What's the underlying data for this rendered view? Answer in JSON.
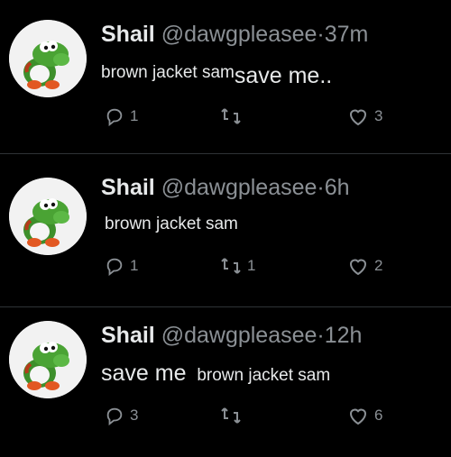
{
  "tweets": [
    {
      "name": "Shail",
      "handle": "@dawgpleasee",
      "dot": "·",
      "time": "37m",
      "text_a": "brown jacket sam",
      "text_b": "save me..",
      "replies": "1",
      "retweets": "",
      "likes": "3"
    },
    {
      "name": "Shail",
      "handle": "@dawgpleasee",
      "dot": "·",
      "time": "6h",
      "text_a": "brown jacket sam",
      "replies": "1",
      "retweets": "1",
      "likes": "2"
    },
    {
      "name": "Shail",
      "handle": "@dawgpleasee",
      "dot": "·",
      "time": "12h",
      "text_a": "save me",
      "text_b": "brown jacket sam",
      "replies": "3",
      "retweets": "",
      "likes": "6"
    }
  ],
  "icons": {
    "reply": "reply-icon",
    "retweet": "retweet-icon",
    "like": "heart-icon",
    "avatar": "yoshi-avatar"
  },
  "colors": {
    "background": "#000000",
    "text": "#e7e9ea",
    "muted": "#8b9095",
    "divider": "#2f3336"
  }
}
